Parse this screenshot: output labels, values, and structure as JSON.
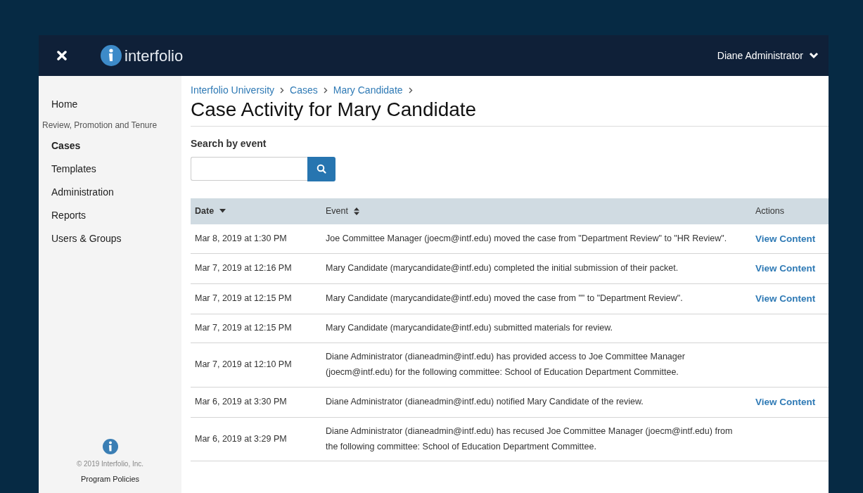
{
  "header": {
    "brand": "interfolio",
    "user": "Diane Administrator"
  },
  "sidebar": {
    "items": [
      {
        "kind": "link",
        "label": "Home",
        "selected": false
      },
      {
        "kind": "heading",
        "label": "Review, Promotion and Tenure"
      },
      {
        "kind": "link",
        "label": "Cases",
        "selected": true
      },
      {
        "kind": "link",
        "label": "Templates",
        "selected": false
      },
      {
        "kind": "link",
        "label": "Administration",
        "selected": false
      },
      {
        "kind": "link",
        "label": "Reports",
        "selected": false
      },
      {
        "kind": "link",
        "label": "Users & Groups",
        "selected": false
      }
    ],
    "footer": {
      "copyright": "© 2019 Interfolio, Inc.",
      "link": "Program Policies"
    }
  },
  "breadcrumbs": [
    "Interfolio University",
    "Cases",
    "Mary Candidate"
  ],
  "title": "Case Activity for Mary Candidate",
  "search": {
    "label": "Search by event"
  },
  "table": {
    "columns": [
      {
        "label": "Date",
        "sortable": true,
        "sorted": true
      },
      {
        "label": "Event",
        "sortable": true,
        "sorted": false
      },
      {
        "label": "Actions",
        "sortable": false,
        "sorted": false
      }
    ],
    "rows": [
      {
        "date": "Mar 8, 2019 at 1:30 PM",
        "event": "Joe Committee Manager (joecm@intf.edu) moved the case from \"Department Review\" to \"HR Review\".",
        "action": "View Content"
      },
      {
        "date": "Mar 7, 2019 at 12:16 PM",
        "event": "Mary Candidate (marycandidate@intf.edu) completed the initial submission of their packet.",
        "action": "View Content"
      },
      {
        "date": "Mar 7, 2019 at 12:15 PM",
        "event": "Mary Candidate (marycandidate@intf.edu) moved the case from \"\" to \"Department Review\".",
        "action": "View Content"
      },
      {
        "date": "Mar 7, 2019 at 12:15 PM",
        "event": "Mary Candidate (marycandidate@intf.edu) submitted materials for review."
      },
      {
        "date": "Mar 7, 2019 at 12:10 PM",
        "event": "Diane Administrator (dianeadmin@intf.edu) has provided access to Joe Committee Manager (joecm@intf.edu) for the following committee: School of Education Department Committee."
      },
      {
        "date": "Mar 6, 2019 at 3:30 PM",
        "event": "Diane Administrator (dianeadmin@intf.edu) notified Mary Candidate of the review.",
        "action": "View Content"
      },
      {
        "date": "Mar 6, 2019 at 3:29 PM",
        "event": "Diane Administrator (dianeadmin@intf.edu) has recused Joe Committee Manager (joecm@intf.edu) from the following committee: School of Education Department Committee."
      }
    ]
  }
}
